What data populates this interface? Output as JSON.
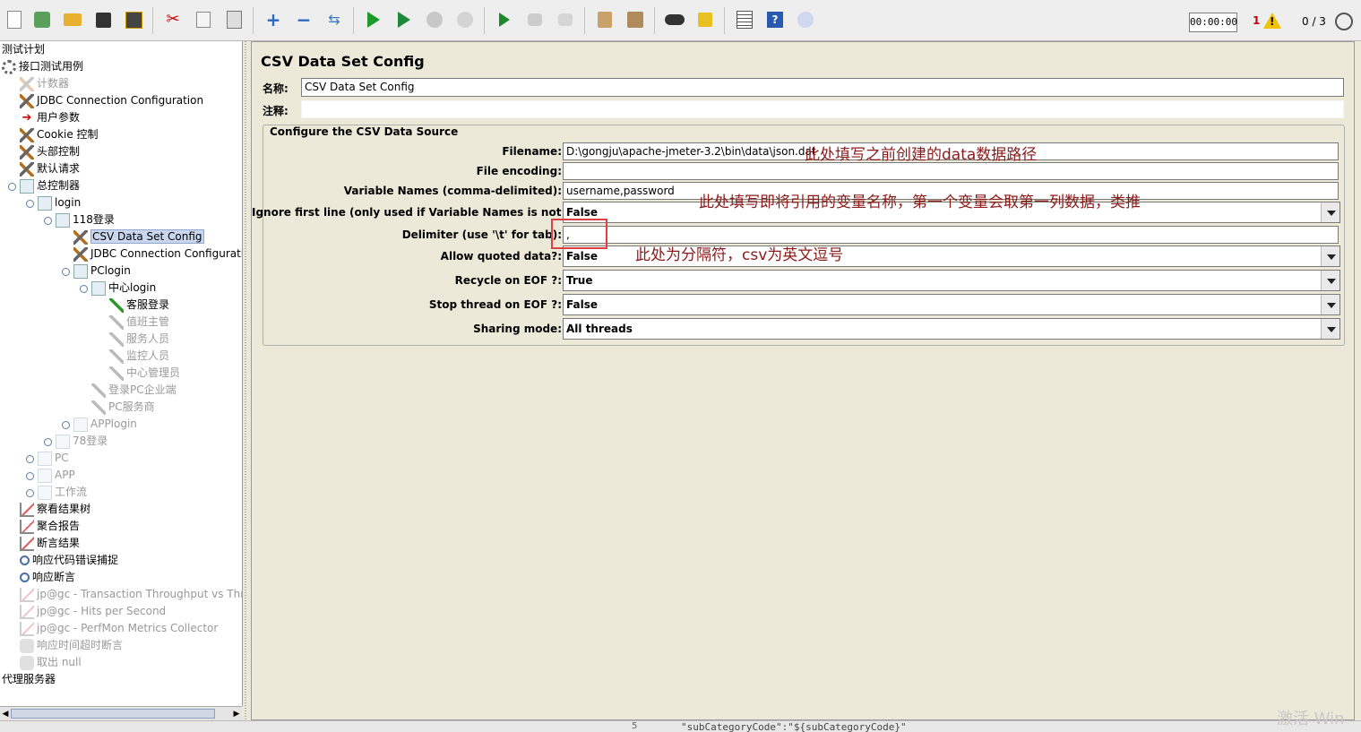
{
  "toolbar": {
    "timer": "00:00:00",
    "error_count": "1",
    "threads": "0 / 3"
  },
  "tree": {
    "items": [
      {
        "label": "测试计划",
        "depth": 0,
        "icon": "none",
        "disabled": false
      },
      {
        "label": "接口测试用例",
        "depth": 0,
        "icon": "gear",
        "disabled": false
      },
      {
        "label": "计数器",
        "depth": 1,
        "icon": "tool",
        "disabled": true
      },
      {
        "label": "JDBC Connection Configuration",
        "depth": 1,
        "icon": "tool",
        "disabled": false
      },
      {
        "label": "用户参数",
        "depth": 1,
        "icon": "arrow",
        "disabled": false
      },
      {
        "label": "Cookie 控制",
        "depth": 1,
        "icon": "tool",
        "disabled": false
      },
      {
        "label": "头部控制",
        "depth": 1,
        "icon": "tool",
        "disabled": false
      },
      {
        "label": "默认请求",
        "depth": 1,
        "icon": "tool",
        "disabled": false
      },
      {
        "label": "总控制器",
        "depth": 1,
        "icon": "folder",
        "disabled": false
      },
      {
        "label": "login",
        "depth": 2,
        "icon": "folder",
        "disabled": false
      },
      {
        "label": "118登录",
        "depth": 3,
        "icon": "folder",
        "disabled": false
      },
      {
        "label": "CSV Data Set Config",
        "depth": 4,
        "icon": "tool",
        "disabled": false,
        "selected": true
      },
      {
        "label": "JDBC Connection Configuratio",
        "depth": 4,
        "icon": "tool",
        "disabled": false
      },
      {
        "label": "PClogin",
        "depth": 4,
        "icon": "folder",
        "disabled": false
      },
      {
        "label": "中心login",
        "depth": 5,
        "icon": "folder",
        "disabled": false
      },
      {
        "label": "客服登录",
        "depth": 6,
        "icon": "pen",
        "disabled": false
      },
      {
        "label": "值班主管",
        "depth": 6,
        "icon": "pen",
        "disabled": true
      },
      {
        "label": "服务人员",
        "depth": 6,
        "icon": "pen",
        "disabled": true
      },
      {
        "label": "监控人员",
        "depth": 6,
        "icon": "pen",
        "disabled": true
      },
      {
        "label": "中心管理员",
        "depth": 6,
        "icon": "pen",
        "disabled": true
      },
      {
        "label": "登录PC企业端",
        "depth": 5,
        "icon": "pen",
        "disabled": true
      },
      {
        "label": "PC服务商",
        "depth": 5,
        "icon": "pen",
        "disabled": true
      },
      {
        "label": "APPlogin",
        "depth": 4,
        "icon": "folder",
        "disabled": true
      },
      {
        "label": "78登录",
        "depth": 3,
        "icon": "folder",
        "disabled": true
      },
      {
        "label": "PC",
        "depth": 2,
        "icon": "folder",
        "disabled": true
      },
      {
        "label": "APP",
        "depth": 2,
        "icon": "folder",
        "disabled": true
      },
      {
        "label": "工作流",
        "depth": 2,
        "icon": "folder",
        "disabled": true
      },
      {
        "label": "察看结果树",
        "depth": 1,
        "icon": "chart",
        "disabled": false
      },
      {
        "label": "聚合报告",
        "depth": 1,
        "icon": "chart",
        "disabled": false
      },
      {
        "label": "断言结果",
        "depth": 1,
        "icon": "chart",
        "disabled": false
      },
      {
        "label": "响应代码错误捕捉",
        "depth": 1,
        "icon": "mag",
        "disabled": false
      },
      {
        "label": "响应断言",
        "depth": 1,
        "icon": "mag",
        "disabled": false
      },
      {
        "label": "jp@gc - Transaction Throughput vs Threa",
        "depth": 1,
        "icon": "chart",
        "disabled": true
      },
      {
        "label": "jp@gc - Hits per Second",
        "depth": 1,
        "icon": "chart",
        "disabled": true
      },
      {
        "label": "jp@gc - PerfMon Metrics Collector",
        "depth": 1,
        "icon": "chart",
        "disabled": true
      },
      {
        "label": "响应时间超时断言",
        "depth": 1,
        "icon": "blob",
        "disabled": true
      },
      {
        "label": "取出 null",
        "depth": 1,
        "icon": "blob",
        "disabled": true
      },
      {
        "label": "代理服务器",
        "depth": 0,
        "icon": "none",
        "disabled": false
      }
    ]
  },
  "panel": {
    "title": "CSV Data Set Config",
    "name_label": "名称:",
    "name_value": "CSV Data Set Config",
    "comment_label": "注释:",
    "comment_value": "",
    "section_title": "Configure the CSV Data Source",
    "filename_label": "Filename:",
    "filename_value": "D:\\gongju\\apache-jmeter-3.2\\bin\\data\\json.dat",
    "encoding_label": "File encoding:",
    "encoding_value": "",
    "varnames_label": "Variable Names (comma-delimited):",
    "varnames_value": "username,password",
    "ignore_label": "Ignore first line (only used if Variable Names is not empty):",
    "ignore_value": "False",
    "delimiter_label": "Delimiter (use '\\t' for tab):",
    "delimiter_value": ",",
    "quoted_label": "Allow quoted data?:",
    "quoted_value": "False",
    "recycle_label": "Recycle on EOF ?:",
    "recycle_value": "True",
    "stop_label": "Stop thread on EOF ?:",
    "stop_value": "False",
    "sharing_label": "Sharing mode:",
    "sharing_value": "All threads"
  },
  "annotations": {
    "filename_note": "此处填写之前创建的data数据路径",
    "varnames_note": "此处填写即将引用的变量名称，第一个变量会取第一列数据，类推",
    "delimiter_note": "此处为分隔符，csv为英文逗号"
  },
  "bottom": {
    "line_number": "5",
    "code": "\"subCategoryCode\":\"${subCategoryCode}\""
  },
  "watermark": "激活 Win",
  "colors": {
    "annotation": "#8b1a1a",
    "highlight_box": "#e04040",
    "selection": "#c8d7ee"
  }
}
